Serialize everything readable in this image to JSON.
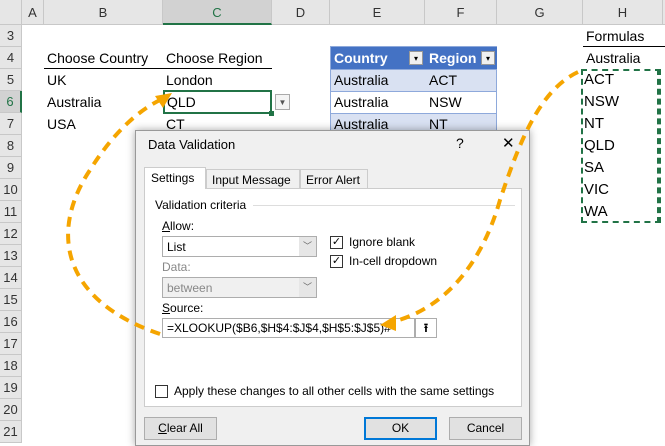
{
  "columns": [
    "A",
    "B",
    "C",
    "D",
    "E",
    "F",
    "G",
    "H"
  ],
  "rows": [
    "3",
    "4",
    "5",
    "6",
    "7",
    "8",
    "9",
    "10",
    "11",
    "12",
    "13",
    "14",
    "15",
    "16",
    "17",
    "18",
    "19",
    "20",
    "21"
  ],
  "sheet": {
    "b4": "Choose Country",
    "c4": "Choose Region",
    "b5": "UK",
    "c5": "London",
    "b6": "Australia",
    "c6": "QLD",
    "b7": "USA",
    "c7": "CT"
  },
  "table": {
    "headers": [
      "Country",
      "Region"
    ],
    "rows": [
      [
        "Australia",
        "ACT"
      ],
      [
        "Australia",
        "NSW"
      ],
      [
        "Australia",
        "NT"
      ]
    ],
    "header_color": "#4472c4",
    "band_color": "#d9e1f2"
  },
  "formulas": {
    "title": "Formulas",
    "header": "Australia",
    "items": [
      "ACT",
      "NSW",
      "NT",
      "QLD",
      "SA",
      "VIC",
      "WA"
    ],
    "border_color": "#217346"
  },
  "dialog": {
    "title": "Data Validation",
    "help": "?",
    "close": "✕",
    "tabs": [
      "Settings",
      "Input Message",
      "Error Alert"
    ],
    "group": "Validation criteria",
    "allow_label": "Allow:",
    "allow_value": "List",
    "data_label": "Data:",
    "data_value": "between",
    "ignore_blank": "Ignore blank",
    "ignore_blank_checked": true,
    "in_cell": "In-cell dropdown",
    "in_cell_checked": true,
    "source_label": "Source:",
    "source_value": "=XLOOKUP($B6,$H$4:$J$4,$H$5:$J$5)#",
    "apply_label": "Apply these changes to all other cells with the same settings",
    "apply_checked": false,
    "clear_all": "Clear All",
    "ok": "OK",
    "cancel": "Cancel"
  },
  "arrow_color": "#f5a500"
}
